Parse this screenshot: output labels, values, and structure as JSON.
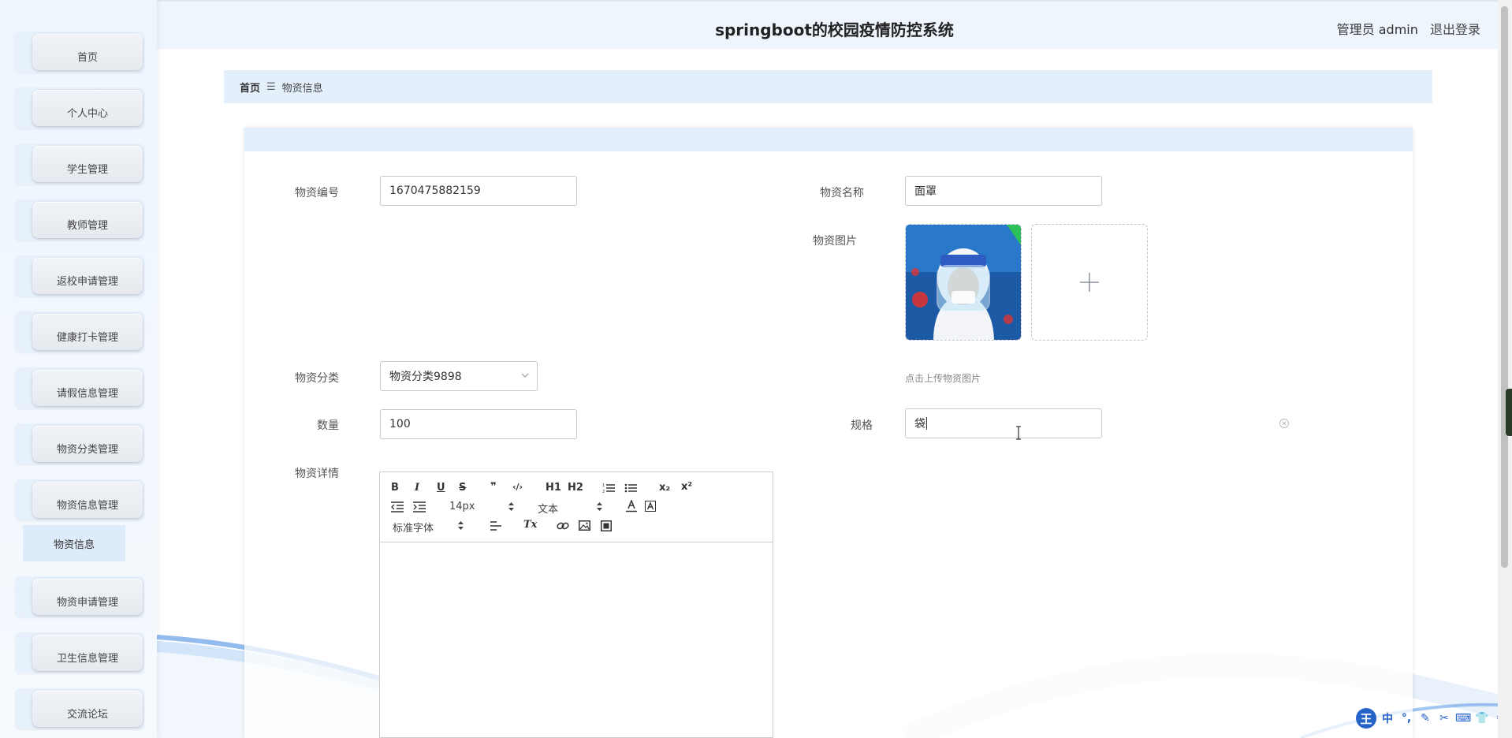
{
  "header": {
    "title": "springboot的校园疫情防控系统",
    "user_role": "管理员 admin",
    "logout_label": "退出登录"
  },
  "sidebar": {
    "items": [
      {
        "label": "首页"
      },
      {
        "label": "个人中心"
      },
      {
        "label": "学生管理"
      },
      {
        "label": "教师管理"
      },
      {
        "label": "返校申请管理"
      },
      {
        "label": "健康打卡管理"
      },
      {
        "label": "请假信息管理"
      },
      {
        "label": "物资分类管理"
      },
      {
        "label": "物资信息管理"
      },
      {
        "label": "物资申请管理"
      },
      {
        "label": "卫生信息管理"
      },
      {
        "label": "交流论坛"
      }
    ],
    "active_sub_item": "物资信息"
  },
  "breadcrumb": {
    "home": "首页",
    "separator": "☰",
    "current": "物资信息"
  },
  "form": {
    "code_label": "物资编号",
    "code_value": "1670475882159",
    "name_label": "物资名称",
    "name_value": "面罩",
    "image_label": "物资图片",
    "image_hint": "点击上传物资图片",
    "category_label": "物资分类",
    "category_value": "物资分类9898",
    "quantity_label": "数量",
    "quantity_value": "100",
    "spec_label": "规格",
    "spec_value": "袋",
    "detail_label": "物资详情"
  },
  "editor": {
    "font_size": "14px",
    "header_type": "文本",
    "font_family": "标准字体",
    "buttons": {
      "bold": "B",
      "italic": "I",
      "underline": "U",
      "strike": "S",
      "quote": "❞",
      "code": "‹/›",
      "h1": "H1",
      "h2": "H2",
      "sub": "x₂",
      "sup": "x²",
      "clean": "Tx"
    }
  },
  "ime": {
    "logo": "王",
    "lang": "中",
    "symbols": [
      "°,",
      "✎",
      "✂",
      "⌨",
      "👕",
      "⚙"
    ]
  },
  "colors": {
    "accent_light": "#e4effc",
    "sidebar_bg": "#eef5fd",
    "ime_blue": "#2563c9"
  }
}
